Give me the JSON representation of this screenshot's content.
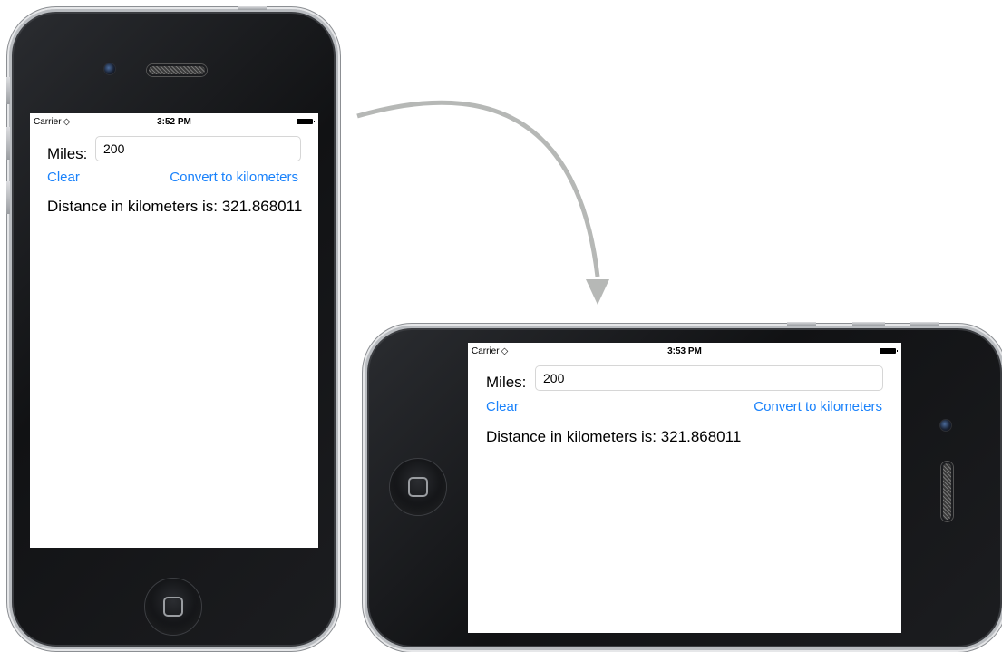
{
  "portrait": {
    "status_bar": {
      "carrier": "Carrier",
      "time": "3:52 PM"
    },
    "miles_label": "Miles:",
    "miles_value": "200",
    "clear_label": "Clear",
    "convert_label": "Convert to kilometers",
    "result_text": "Distance in kilometers is: 321.868011"
  },
  "landscape": {
    "status_bar": {
      "carrier": "Carrier",
      "time": "3:53 PM"
    },
    "miles_label": "Miles:",
    "miles_value": "200",
    "clear_label": "Clear",
    "convert_label": "Convert to kilometers",
    "result_text": "Distance in kilometers is: 321.868011"
  },
  "icons": {
    "wifi": "wifi-icon",
    "battery": "battery-icon",
    "camera": "camera-icon",
    "speaker": "speaker-icon",
    "home": "home-button-icon",
    "rotate_arrow": "rotate-arrow-icon"
  },
  "colors": {
    "link": "#1a82fb",
    "arrow": "#b6b8b6",
    "phone_body": "#111214",
    "phone_bezel": "#b9bcc0"
  }
}
